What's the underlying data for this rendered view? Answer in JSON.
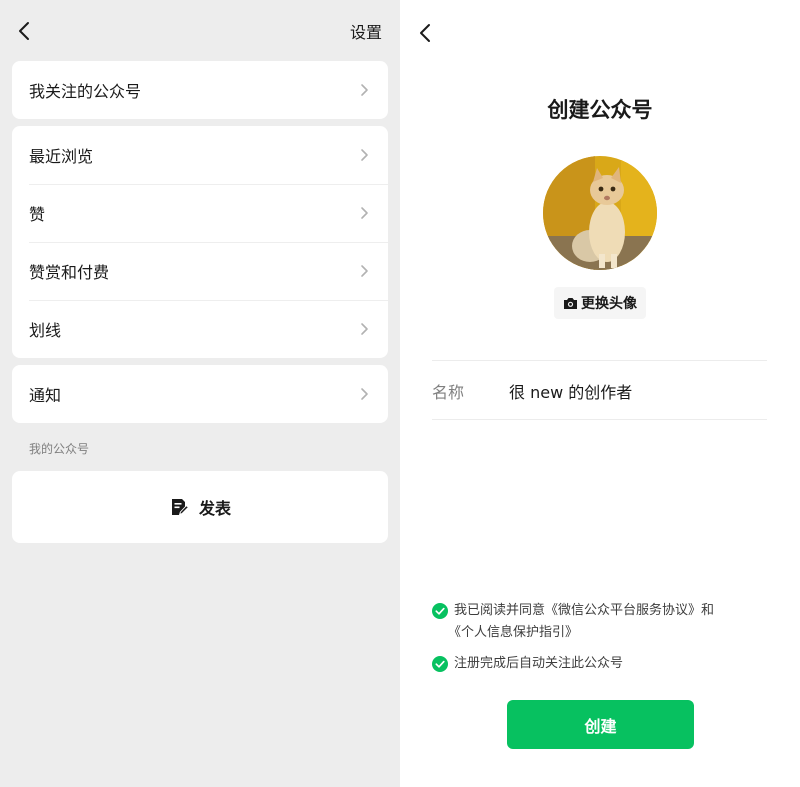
{
  "colors": {
    "accent_green": "#07c160",
    "bg_gray": "#ededed"
  },
  "left": {
    "back_icon": "chevron-left-icon",
    "settings_label": "设置",
    "groups": [
      [
        {
          "label": "我关注的公众号"
        }
      ],
      [
        {
          "label": "最近浏览"
        },
        {
          "label": "赞"
        },
        {
          "label": "赞赏和付费"
        },
        {
          "label": "划线"
        }
      ],
      [
        {
          "label": "通知"
        }
      ]
    ],
    "my_section_label": "我的公众号",
    "publish_label": "发表",
    "publish_icon": "edit-document-icon"
  },
  "right": {
    "back_icon": "chevron-left-icon",
    "title": "创建公众号",
    "change_avatar_label": "更换头像",
    "camera_icon": "camera-icon",
    "name_label": "名称",
    "name_value": "很 new 的创作者",
    "agree_line1": "我已阅读并同意《微信公众平台服务协议》和",
    "agree_line2": "《个人信息保护指引》",
    "follow_text": "注册完成后自动关注此公众号",
    "create_button_label": "创建"
  }
}
